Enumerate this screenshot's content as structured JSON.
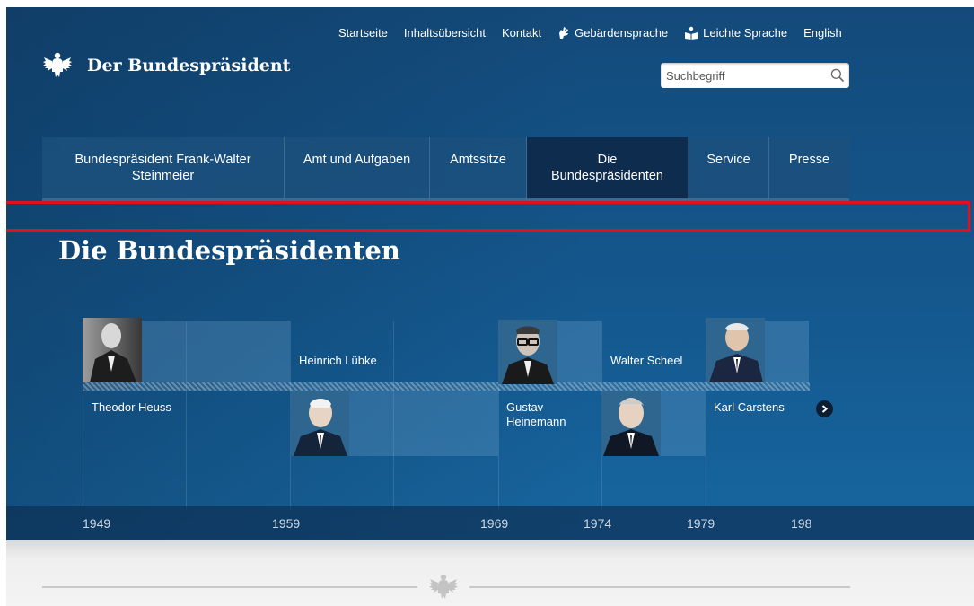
{
  "site": {
    "name": "Der Bundespräsident"
  },
  "topnav": {
    "items": [
      {
        "label": "Startseite",
        "icon": ""
      },
      {
        "label": "Inhaltsübersicht",
        "icon": ""
      },
      {
        "label": "Kontakt",
        "icon": ""
      },
      {
        "label": "Gebärdensprache",
        "icon": "sign-language-icon"
      },
      {
        "label": "Leichte Sprache",
        "icon": "easy-language-icon"
      },
      {
        "label": "English",
        "icon": ""
      }
    ]
  },
  "search": {
    "placeholder": "Suchbegriff",
    "icon": "search-icon"
  },
  "mainnav": {
    "tabs": [
      {
        "label": "Bundespräsident Frank-Walter Steinmeier",
        "active": false
      },
      {
        "label": "Amt und Aufgaben",
        "active": false
      },
      {
        "label": "Amtssitze",
        "active": false
      },
      {
        "label": "Die Bundespräsidenten",
        "active": true
      },
      {
        "label": "Service",
        "active": false
      },
      {
        "label": "Presse",
        "active": false
      }
    ]
  },
  "page": {
    "title": "Die Bundespräsidenten"
  },
  "timeline": {
    "presidents": [
      {
        "name": "Theodor Heuss"
      },
      {
        "name": "Heinrich Lübke"
      },
      {
        "name": "Gustav Heinemann"
      },
      {
        "name": "Walter Scheel"
      },
      {
        "name": "Karl Carstens"
      }
    ],
    "years": [
      "1949",
      "1959",
      "1969",
      "1974",
      "1979",
      "198"
    ],
    "next_icon": "chevron-right-icon"
  },
  "colors": {
    "background": "#14558a",
    "active_tab": "#0e2c4e",
    "highlight": "#e0111d"
  }
}
